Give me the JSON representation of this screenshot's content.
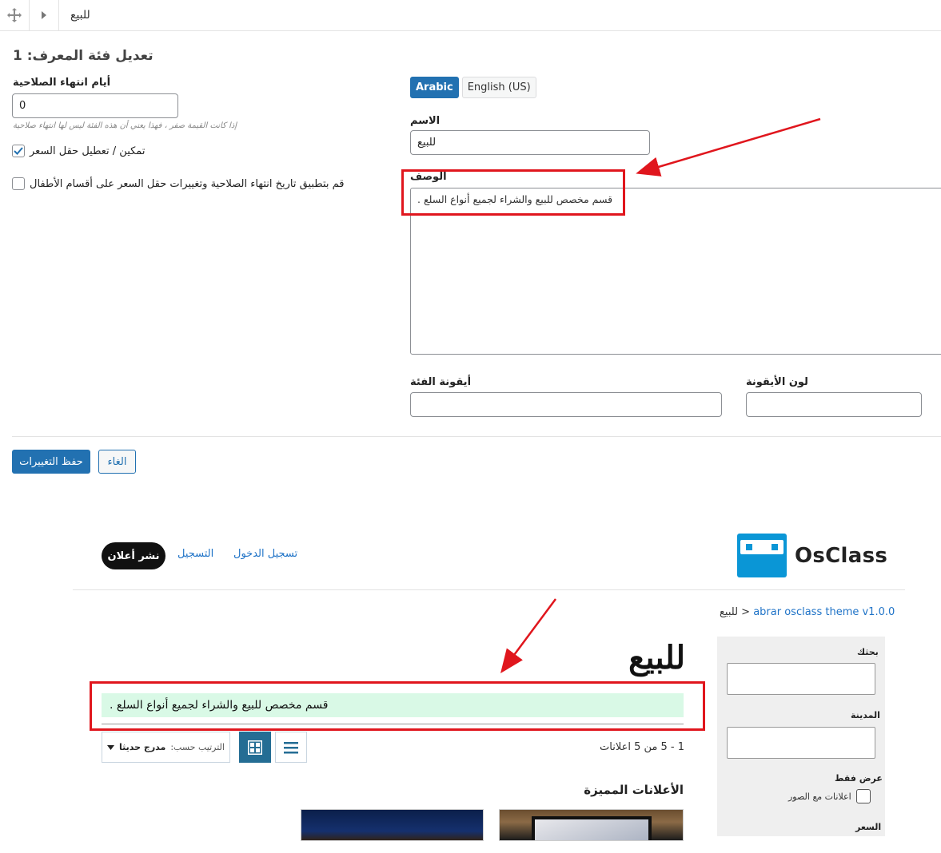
{
  "admin": {
    "breadcrumb": "للبيع",
    "form_title": "تعديل فئة المعرف: 1",
    "expiration": {
      "label": "أيام انتهاء الصلاحية",
      "value": "0",
      "hint": "إذا كانت القيمة صفر ، فهذا يعني أن هذه الفئة ليس لها انتهاء صلاحية"
    },
    "price_toggle": {
      "label": "تمكين / تعطيل حقل السعر",
      "checked": true
    },
    "apply_children": {
      "label": "قم بتطبيق تاريخ انتهاء الصلاحية وتغييرات حقل السعر على أقسام الأطفال",
      "checked": false
    },
    "language_tabs": [
      {
        "label": "Arabic",
        "active": true
      },
      {
        "label": "English (US)",
        "active": false
      }
    ],
    "name": {
      "label": "الاسم",
      "value": "للبيع"
    },
    "description": {
      "label": "الوصف",
      "value": "قسم مخصص للبيع والشراء لجميع أنواع السلع ."
    },
    "category_icon": {
      "label": "أيقونة الفئة",
      "value": ""
    },
    "icon_color": {
      "label": "لون الأيقونة",
      "value": ""
    },
    "save_button": "حفظ التغييرات",
    "cancel_button": "الغاء"
  },
  "site": {
    "logo_text": "OsClass",
    "nav": {
      "login": "تسجيل الدخول",
      "register": "التسجيل",
      "post_ad": "نشر أعلان"
    },
    "breadcrumb": {
      "home": "abrar osclass theme v1.0.0",
      "separator": ">",
      "current": "للبيع"
    },
    "category_title": "للبيع",
    "category_description": "قسم مخصص للبيع والشراء لجميع أنواع السلع .",
    "results_count": "1 - 5 من 5 اعلانات",
    "sort": {
      "label": "الترتيب حسب:",
      "value": "مدرج حديثا"
    },
    "premium_title": "الأعلانات المميزة",
    "sidebar": {
      "search_label": "بحثك",
      "city_label": "المدينة",
      "show_only_label": "عرض فقط",
      "with_photos_label": "اعلانات مع الصور",
      "price_label": "السعر"
    }
  },
  "colors": {
    "admin_primary": "#2271b1",
    "annotation_red": "#e0161d",
    "logo_blue": "#0a96d6",
    "banner_green": "#d9f9e6"
  }
}
